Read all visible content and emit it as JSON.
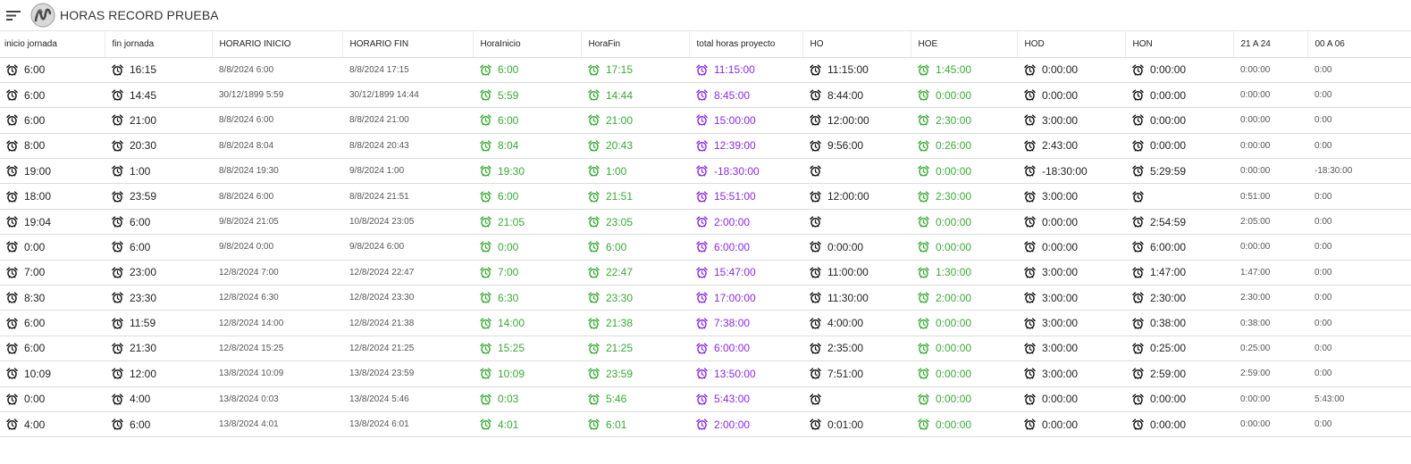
{
  "app": {
    "title": "HORAS RECORD PRUEBA"
  },
  "colors": {
    "green": "#3aa935",
    "purple": "#8a2be2",
    "black": "#222222"
  },
  "columns": [
    {
      "key": "inicio",
      "label": "inicio jornada",
      "icon": true,
      "color": "black"
    },
    {
      "key": "fin",
      "label": "fin jornada",
      "icon": true,
      "color": "black"
    },
    {
      "key": "hinicio",
      "label": "HORARIO INICIO",
      "icon": false,
      "color": "gray",
      "small": true
    },
    {
      "key": "hfin",
      "label": "HORARIO FIN",
      "icon": false,
      "color": "gray",
      "small": true
    },
    {
      "key": "horainicio",
      "label": "HoraInicio",
      "icon": true,
      "color": "green"
    },
    {
      "key": "horafin",
      "label": "HoraFin",
      "icon": true,
      "color": "green"
    },
    {
      "key": "total",
      "label": "total horas proyecto",
      "icon": true,
      "color": "purple"
    },
    {
      "key": "ho",
      "label": "HO",
      "icon": true,
      "color": "black"
    },
    {
      "key": "hoe",
      "label": "HOE",
      "icon": true,
      "color": "green"
    },
    {
      "key": "hod",
      "label": "HOD",
      "icon": true,
      "color": "black"
    },
    {
      "key": "hon",
      "label": "HON",
      "icon": true,
      "color": "black"
    },
    {
      "key": "h2124",
      "label": "21 A 24",
      "icon": false,
      "color": "gray",
      "small": true
    },
    {
      "key": "h0006",
      "label": "00 A 06",
      "icon": false,
      "color": "gray",
      "small": true
    }
  ],
  "rows": [
    [
      "6:00",
      "16:15",
      "8/8/2024 6:00",
      "8/8/2024 17:15",
      "6:00",
      "17:15",
      "11:15:00",
      "11:15:00",
      "1:45:00",
      "0:00:00",
      "0:00:00",
      "0:00:00",
      "0:00"
    ],
    [
      "6:00",
      "14:45",
      "30/12/1899 5:59",
      "30/12/1899 14:44",
      "5:59",
      "14:44",
      "8:45:00",
      "8:44:00",
      "0:00:00",
      "0:00:00",
      "0:00:00",
      "0:00:00",
      "0:00"
    ],
    [
      "6:00",
      "21:00",
      "8/8/2024 6:00",
      "8/8/2024 21:00",
      "6:00",
      "21:00",
      "15:00:00",
      "12:00:00",
      "2:30:00",
      "3:00:00",
      "0:00:00",
      "0:00:00",
      "0:00"
    ],
    [
      "8:00",
      "20:30",
      "8/8/2024 8:04",
      "8/8/2024 20:43",
      "8:04",
      "20:43",
      "12:39:00",
      "9:56:00",
      "0:26:00",
      "2:43:00",
      "0:00:00",
      "0:00:00",
      "0:00"
    ],
    [
      "19:00",
      "1:00",
      "8/8/2024 19:30",
      "9/8/2024 1:00",
      "19:30",
      "1:00",
      "-18:30:00",
      "",
      "0:00:00",
      "-18:30:00",
      "5:29:59",
      "0:00:00",
      "-18:30:00"
    ],
    [
      "18:00",
      "23:59",
      "8/8/2024 6:00",
      "8/8/2024 21:51",
      "6:00",
      "21:51",
      "15:51:00",
      "12:00:00",
      "2:30:00",
      "3:00:00",
      "",
      "0:51:00",
      "0:00"
    ],
    [
      "19:04",
      "6:00",
      "9/8/2024 21:05",
      "10/8/2024 23:05",
      "21:05",
      "23:05",
      "2:00:00",
      "",
      "0:00:00",
      "0:00:00",
      "2:54:59",
      "2:05:00",
      "0:00"
    ],
    [
      "0:00",
      "6:00",
      "9/8/2024 0:00",
      "9/8/2024 6:00",
      "0:00",
      "6:00",
      "6:00:00",
      "0:00:00",
      "0:00:00",
      "0:00:00",
      "6:00:00",
      "0:00:00",
      "0:00"
    ],
    [
      "7:00",
      "23:00",
      "12/8/2024 7:00",
      "12/8/2024 22:47",
      "7:00",
      "22:47",
      "15:47:00",
      "11:00:00",
      "1:30:00",
      "3:00:00",
      "1:47:00",
      "1:47:00",
      "0:00"
    ],
    [
      "8:30",
      "23:30",
      "12/8/2024 6:30",
      "12/8/2024 23:30",
      "6:30",
      "23:30",
      "17:00:00",
      "11:30:00",
      "2:00:00",
      "3:00:00",
      "2:30:00",
      "2:30:00",
      "0:00"
    ],
    [
      "6:00",
      "11:59",
      "12/8/2024 14:00",
      "12/8/2024 21:38",
      "14:00",
      "21:38",
      "7:38:00",
      "4:00:00",
      "0:00:00",
      "3:00:00",
      "0:38:00",
      "0:38:00",
      "0:00"
    ],
    [
      "6:00",
      "21:30",
      "12/8/2024 15:25",
      "12/8/2024 21:25",
      "15:25",
      "21:25",
      "6:00:00",
      "2:35:00",
      "0:00:00",
      "3:00:00",
      "0:25:00",
      "0:25:00",
      "0:00"
    ],
    [
      "10:09",
      "12:00",
      "13/8/2024 10:09",
      "13/8/2024 23:59",
      "10:09",
      "23:59",
      "13:50:00",
      "7:51:00",
      "0:00:00",
      "3:00:00",
      "2:59:00",
      "2:59:00",
      "0:00"
    ],
    [
      "0:00",
      "4:00",
      "13/8/2024 0:03",
      "13/8/2024 5:46",
      "0:03",
      "5:46",
      "5:43:00",
      "",
      "0:00:00",
      "0:00:00",
      "0:00:00",
      "0:00:00",
      "5:43:00"
    ],
    [
      "4:00",
      "6:00",
      "13/8/2024 4:01",
      "13/8/2024 6:01",
      "4:01",
      "6:01",
      "2:00:00",
      "0:01:00",
      "0:00:00",
      "0:00:00",
      "0:00:00",
      "0:00:00",
      "0:00"
    ]
  ]
}
